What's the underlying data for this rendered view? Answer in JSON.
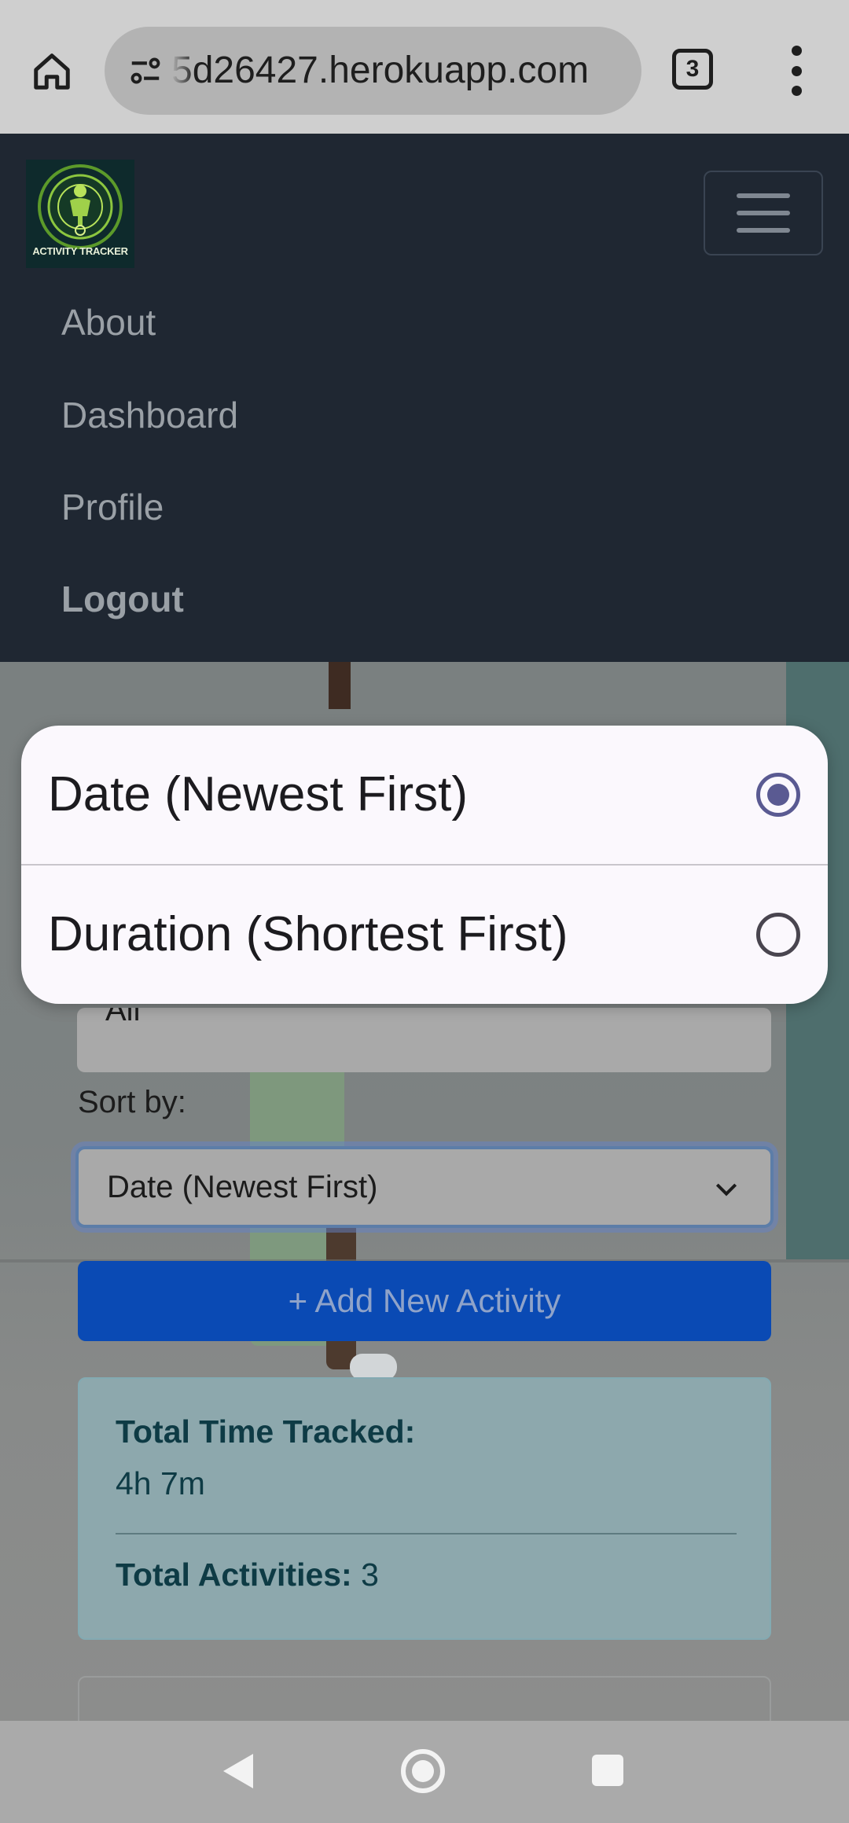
{
  "browser": {
    "url": "5d26427.herokuapp.com",
    "tab_count": "3"
  },
  "navbar": {
    "logo_text": "ACTIVITY TRACKER",
    "items": [
      {
        "label": "About"
      },
      {
        "label": "Dashboard"
      },
      {
        "label": "Profile"
      },
      {
        "label": "Logout"
      }
    ]
  },
  "page": {
    "filter_value": "All",
    "sort_label": "Sort by:",
    "sort_value": "Date (Newest First)",
    "add_button": "+ Add New Activity",
    "stats": {
      "total_time_label": "Total Time Tracked:",
      "total_time_value": "4h 7m",
      "total_activities_label": "Total Activities:",
      "total_activities_value": "3"
    }
  },
  "sort_popup": {
    "options": [
      {
        "label": "Date (Newest First)",
        "selected": true
      },
      {
        "label": "Duration (Shortest First)",
        "selected": false
      }
    ]
  },
  "colors": {
    "navbar_bg": "#1f2732",
    "add_button": "#0a4ab4",
    "radio_selected": "#5a5a92"
  }
}
